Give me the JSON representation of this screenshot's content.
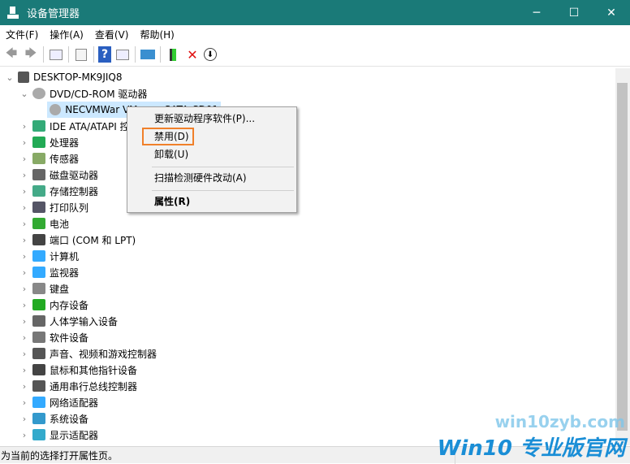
{
  "window": {
    "title": "设备管理器",
    "minimize": "─",
    "maximize": "☐",
    "close": "✕"
  },
  "menu": [
    "文件(F)",
    "操作(A)",
    "查看(V)",
    "帮助(H)"
  ],
  "toolbar": {
    "back": "🡄",
    "forward": "🡆",
    "help": "?",
    "delete": "✕",
    "down": "⬇"
  },
  "tree": {
    "root": "DESKTOP-MK9JIQ8",
    "dvd": "DVD/CD-ROM 驱动器",
    "dvd_child": "NECVMWar VMware SATA CD01",
    "categories": [
      "IDE ATA/ATAPI 控制器",
      "处理器",
      "传感器",
      "磁盘驱动器",
      "存储控制器",
      "打印队列",
      "电池",
      "端口 (COM 和 LPT)",
      "计算机",
      "监视器",
      "键盘",
      "内存设备",
      "人体学输入设备",
      "软件设备",
      "声音、视频和游戏控制器",
      "鼠标和其他指针设备",
      "通用串行总线控制器",
      "网络适配器",
      "系统设备",
      "显示适配器"
    ]
  },
  "context_menu": {
    "update": "更新驱动程序软件(P)...",
    "disable": "禁用(D)",
    "uninstall": "卸载(U)",
    "scan": "扫描检测硬件改动(A)",
    "properties": "属性(R)"
  },
  "status": "为当前的选择打开属性页。",
  "watermark": {
    "line1": "win10zyb.com",
    "line2": "Win10 专业版官网"
  },
  "colors": {
    "titlebar": "#1a7a78",
    "highlight": "#f0802a",
    "selection": "#cce8ff"
  }
}
